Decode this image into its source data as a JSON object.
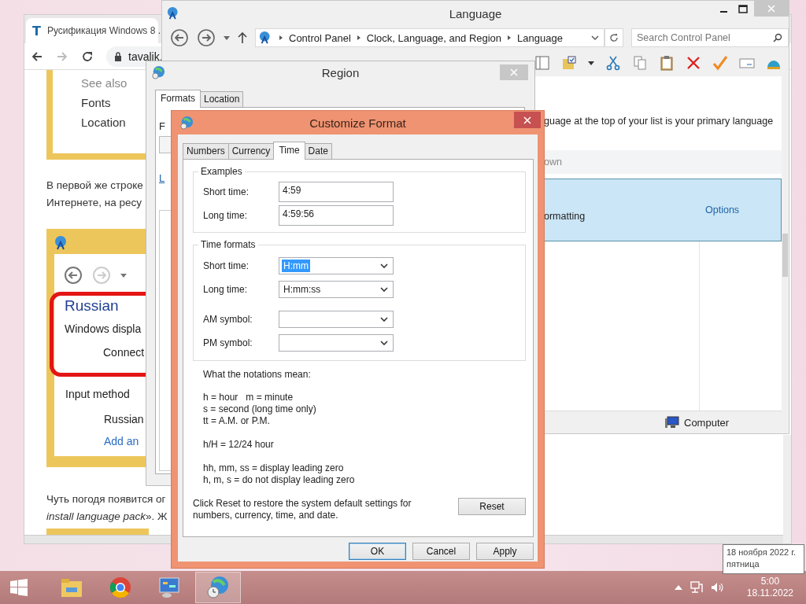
{
  "browser": {
    "tab": {
      "logo": "T",
      "title": "Русификация Windows 8 ."
    },
    "url": "tavalik.",
    "article": {
      "figure_1": {
        "heading": "See also",
        "links": [
          "Fonts",
          "Location"
        ]
      },
      "paragraph_1": [
        "В первой же строке",
        "Интернете, на ресу"
      ],
      "figure_2": {
        "title": "Russian",
        "subtitle": "Windows displa",
        "action": "Connect",
        "section": "Input method",
        "method": "Russian",
        "link": "Add an"
      },
      "paragraph_2": [
        "Чуть погодя появится ог",
        "*install language pack*». Ж"
      ]
    }
  },
  "language_window": {
    "title": "Language",
    "breadcrumbs": [
      "Control Panel",
      "Clock, Language, and Region",
      "Language"
    ],
    "search": {
      "placeholder": "Search Control Panel"
    },
    "intro": "guage at the top of your list is your primary language",
    "column_header": "own",
    "row": {
      "text": "ormatting",
      "link": "Options",
      "selected": true
    },
    "status": "Computer"
  },
  "region_window": {
    "title": "Region",
    "tabs": [
      {
        "label": "Formats",
        "selected": true
      },
      {
        "label": "Location",
        "selected": false
      }
    ],
    "label": "F",
    "link": "L"
  },
  "customize_dialog": {
    "title": "Customize Format",
    "tabs": [
      {
        "label": "Numbers",
        "selected": false
      },
      {
        "label": "Currency",
        "selected": false
      },
      {
        "label": "Time",
        "selected": true
      },
      {
        "label": "Date",
        "selected": false
      }
    ],
    "examples": {
      "title": "Examples",
      "fields": [
        {
          "label": "Short time:",
          "value": "4:59"
        },
        {
          "label": "Long time:",
          "value": "4:59:56"
        }
      ]
    },
    "time_formats": {
      "title": "Time formats",
      "fields": [
        {
          "label": "Short time:",
          "value": "H:mm",
          "text_selected": true
        },
        {
          "label": "Long time:",
          "value": "H:mm:ss",
          "text_selected": false
        },
        {
          "label": "AM symbol:"
        },
        {
          "label": "PM symbol:"
        }
      ]
    },
    "notations": {
      "title": "What the notations mean:",
      "groups": [
        [
          "h = hour   m = minute",
          "s = second (long time only)",
          "tt = A.M. or P.M."
        ],
        [
          "h/H = 12/24 hour"
        ],
        [
          "hh, mm, ss = display leading zero",
          "h, m, s = do not display leading zero"
        ]
      ]
    },
    "reset_note": "Click Reset to restore the system default settings for numbers, currency, time, and date.",
    "reset_button": "Reset",
    "buttons": [
      {
        "label": "OK",
        "default": true
      },
      {
        "label": "Cancel",
        "default": false
      },
      {
        "label": "Apply",
        "default": false
      }
    ]
  },
  "taskbar": {
    "apps": [
      {
        "kind": "explorer",
        "selected": false
      },
      {
        "kind": "chrome",
        "selected": false
      },
      {
        "kind": "control-panel",
        "selected": false
      },
      {
        "kind": "region",
        "selected": true
      }
    ],
    "clock": {
      "time": "5:00",
      "date": "18.11.2022"
    },
    "tooltip": [
      "18 ноября 2022 г.",
      "пятница"
    ]
  }
}
